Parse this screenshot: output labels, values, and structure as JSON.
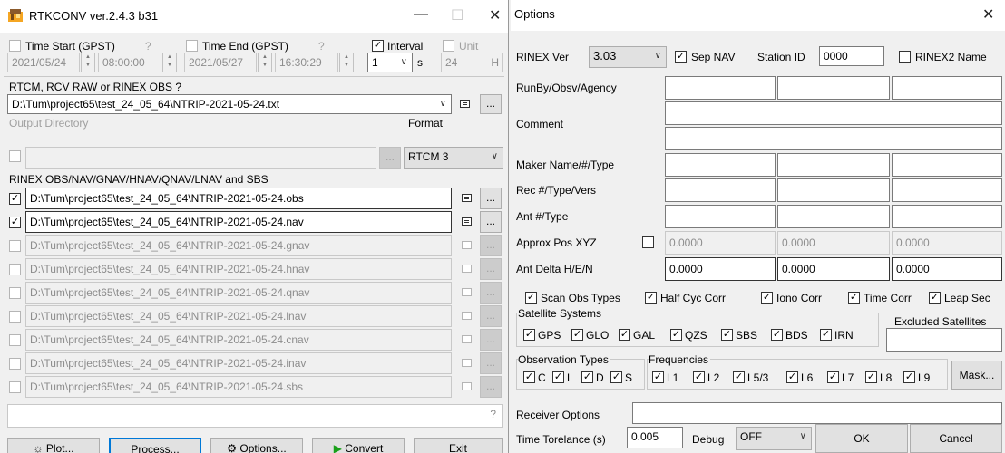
{
  "left": {
    "title": "RTKCONV ver.2.4.3 b31",
    "time_start": {
      "label": "Time Start (GPST)",
      "help": "?",
      "date": "2021/05/24",
      "time": "08:00:00"
    },
    "time_end": {
      "label": "Time End (GPST)",
      "help": "?",
      "date": "2021/05/27",
      "time": "16:30:29"
    },
    "interval": {
      "label": "Interval",
      "value": "1",
      "unit": "s"
    },
    "unit": {
      "label": "Unit",
      "value": "24",
      "suffix": "H"
    },
    "input_label": "RTCM, RCV RAW or RINEX OBS  ?",
    "input_file": "D:\\Tum\\project65\\test_24_05_64\\NTRIP-2021-05-24.txt",
    "output_dir_label": "Output Directory",
    "format_label": "Format",
    "format_value": "RTCM 3",
    "outputs_label": "RINEX OBS/NAV/GNAV/HNAV/QNAV/LNAV and SBS",
    "outputs": [
      {
        "path": "D:\\Tum\\project65\\test_24_05_64\\NTRIP-2021-05-24.obs",
        "checked": true
      },
      {
        "path": "D:\\Tum\\project65\\test_24_05_64\\NTRIP-2021-05-24.nav",
        "checked": true
      },
      {
        "path": "D:\\Tum\\project65\\test_24_05_64\\NTRIP-2021-05-24.gnav",
        "checked": false
      },
      {
        "path": "D:\\Tum\\project65\\test_24_05_64\\NTRIP-2021-05-24.hnav",
        "checked": false
      },
      {
        "path": "D:\\Tum\\project65\\test_24_05_64\\NTRIP-2021-05-24.qnav",
        "checked": false
      },
      {
        "path": "D:\\Tum\\project65\\test_24_05_64\\NTRIP-2021-05-24.lnav",
        "checked": false
      },
      {
        "path": "D:\\Tum\\project65\\test_24_05_64\\NTRIP-2021-05-24.cnav",
        "checked": false
      },
      {
        "path": "D:\\Tum\\project65\\test_24_05_64\\NTRIP-2021-05-24.inav",
        "checked": false
      },
      {
        "path": "D:\\Tum\\project65\\test_24_05_64\\NTRIP-2021-05-24.sbs",
        "checked": false
      }
    ],
    "status_help": "?",
    "browse": "...",
    "buttons": {
      "plot": "Plot...",
      "process": "Process...",
      "options": "Options...",
      "convert": "Convert",
      "exit": "Exit"
    }
  },
  "right": {
    "title": "Options",
    "rinex_ver_label": "RINEX Ver",
    "rinex_ver": "3.03",
    "sep_nav": "Sep NAV",
    "station_id_label": "Station ID",
    "station_id": "0000",
    "rinex2_name": "RINEX2 Name",
    "runby": "RunBy/Obsv/Agency",
    "comment": "Comment",
    "maker": "Maker Name/#/Type",
    "rec": "Rec #/Type/Vers",
    "ant": "Ant #/Type",
    "approx_pos": "Approx Pos XYZ",
    "approx_values": [
      "0.0000",
      "0.0000",
      "0.0000"
    ],
    "ant_delta": "Ant Delta H/E/N",
    "ant_delta_values": [
      "0.0000",
      "0.0000",
      "0.0000"
    ],
    "opts": [
      "Scan Obs Types",
      "Half Cyc Corr",
      "Iono Corr",
      "Time Corr",
      "Leap Sec"
    ],
    "sat_sys_label": "Satellite Systems",
    "sat_sys": [
      "GPS",
      "GLO",
      "GAL",
      "QZS",
      "SBS",
      "BDS",
      "IRN"
    ],
    "excluded_label": "Excluded Satellites",
    "obs_types_label": "Observation Types",
    "obs_types": [
      "C",
      "L",
      "D",
      "S"
    ],
    "freq_label": "Frequencies",
    "freqs": [
      "L1",
      "L2",
      "L5/3",
      "L6",
      "L7",
      "L8",
      "L9"
    ],
    "mask": "Mask...",
    "receiver_options": "Receiver Options",
    "time_tol_label": "Time Torelance (s)",
    "time_tol": "0.005",
    "debug_label": "Debug",
    "debug_value": "OFF",
    "ok": "OK",
    "cancel": "Cancel"
  }
}
